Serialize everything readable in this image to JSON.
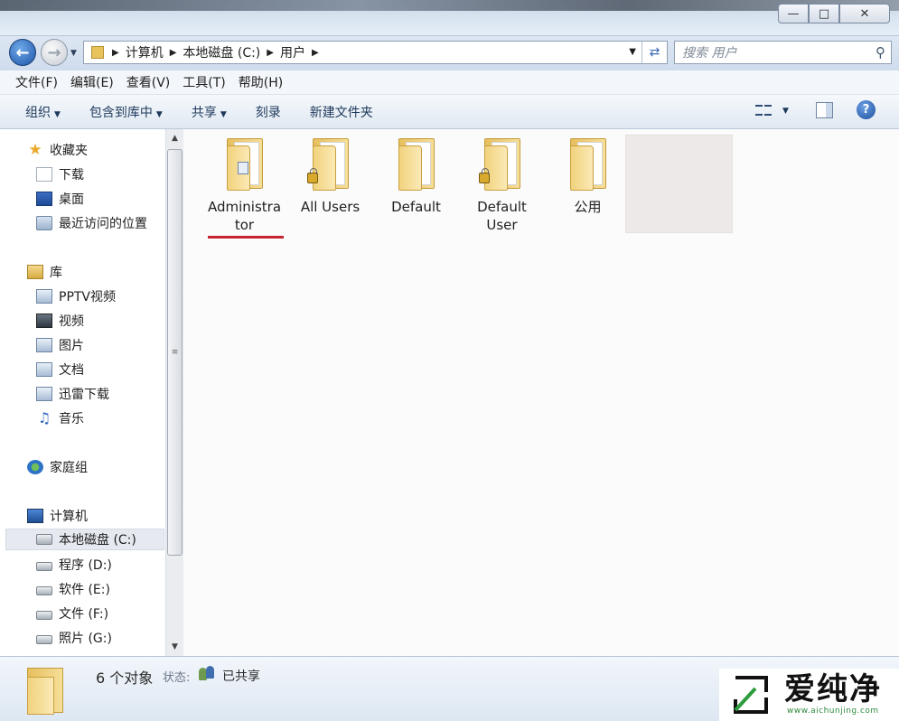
{
  "window": {
    "buttons": [
      "minimize",
      "maximize",
      "close"
    ]
  },
  "address": {
    "breadcrumbs": [
      "计算机",
      "本地磁盘 (C:)",
      "用户"
    ],
    "search_placeholder": "搜索 用户"
  },
  "menu": [
    "文件(F)",
    "编辑(E)",
    "查看(V)",
    "工具(T)",
    "帮助(H)"
  ],
  "commands": [
    {
      "label": "组织",
      "dropdown": true
    },
    {
      "label": "包含到库中",
      "dropdown": true
    },
    {
      "label": "共享",
      "dropdown": true
    },
    {
      "label": "刻录",
      "dropdown": false
    },
    {
      "label": "新建文件夹",
      "dropdown": false
    }
  ],
  "nav": {
    "favorites": {
      "label": "收藏夹",
      "items": [
        "下载",
        "桌面",
        "最近访问的位置"
      ]
    },
    "libraries": {
      "label": "库",
      "items": [
        "PPTV视频",
        "视频",
        "图片",
        "文档",
        "迅雷下载",
        "音乐"
      ]
    },
    "homegroup": {
      "label": "家庭组"
    },
    "computer": {
      "label": "计算机",
      "items": [
        "本地磁盘 (C:)",
        "程序 (D:)",
        "软件 (E:)",
        "文件 (F:)",
        "照片 (G:)"
      ],
      "selected": "本地磁盘 (C:)"
    }
  },
  "folders": [
    {
      "name_line1": "Administra",
      "name_line2": "tor",
      "locked": false,
      "highlighted": true
    },
    {
      "name_line1": "All Users",
      "name_line2": "",
      "locked": true,
      "highlighted": false
    },
    {
      "name_line1": "Default",
      "name_line2": "",
      "locked": false,
      "highlighted": false
    },
    {
      "name_line1": "Default",
      "name_line2": "User",
      "locked": true,
      "highlighted": false
    },
    {
      "name_line1": "公用",
      "name_line2": "",
      "locked": false,
      "highlighted": false
    }
  ],
  "status": {
    "count": "6 个对象",
    "state_label": "状态:",
    "state_value": "已共享"
  },
  "watermark": {
    "text": "爱纯净",
    "url": "www.aichunjing.com"
  },
  "colors": {
    "accent_underline": "#c72330",
    "folder_yellow": "#f1d37e"
  }
}
